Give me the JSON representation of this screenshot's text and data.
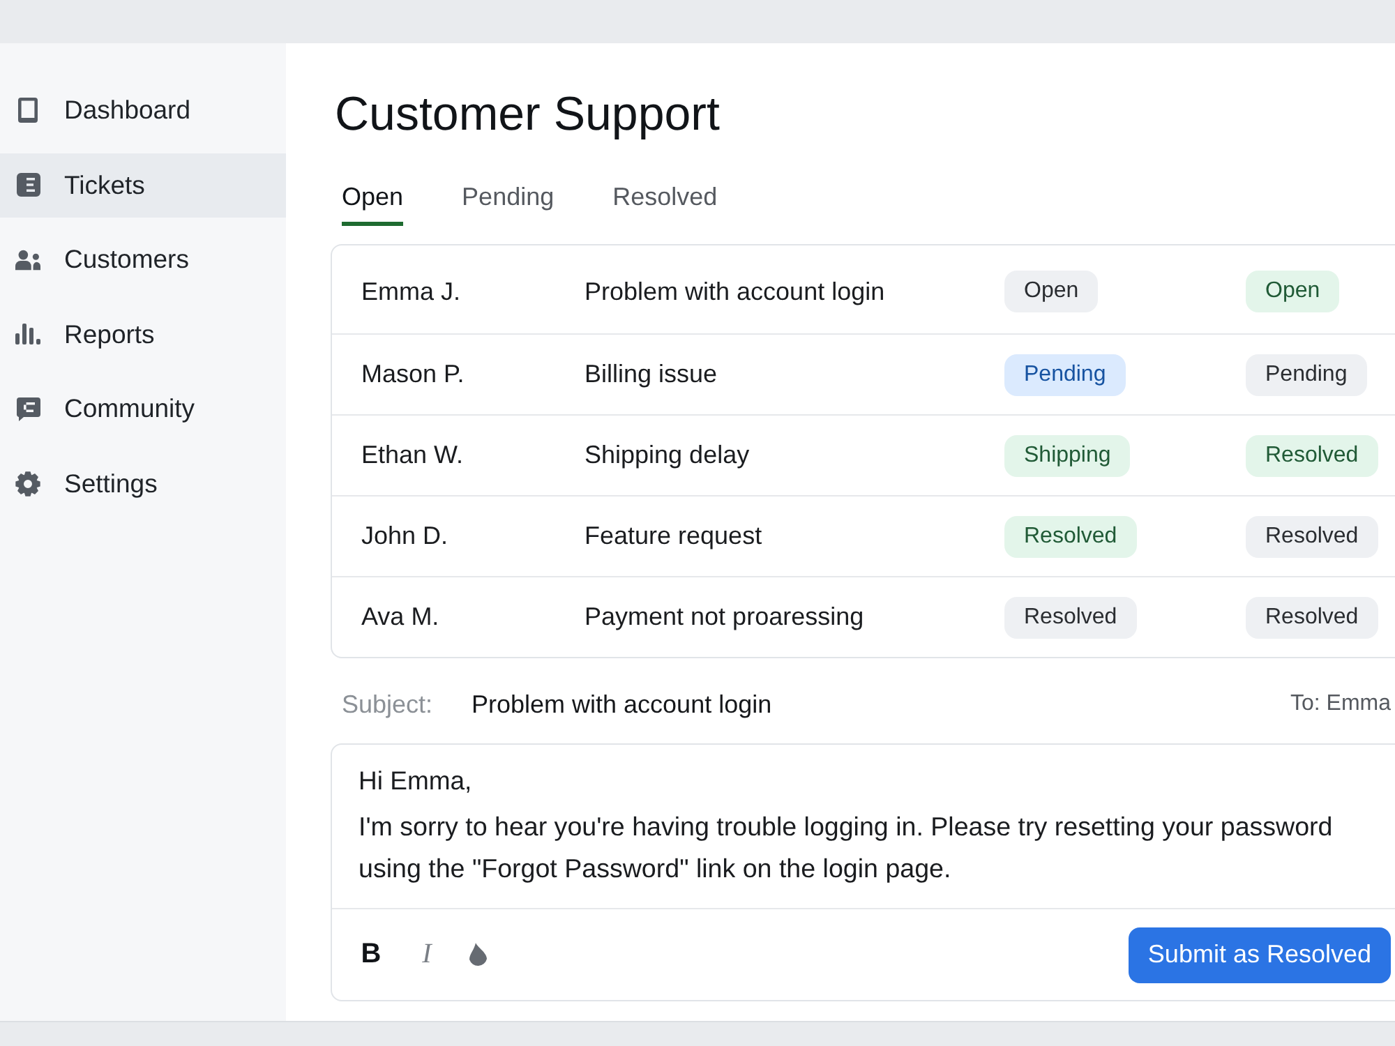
{
  "sidebar": {
    "items": [
      {
        "label": "Dashboard",
        "selected": false
      },
      {
        "label": "Tickets",
        "selected": true
      },
      {
        "label": "Customers",
        "selected": false
      },
      {
        "label": "Reports",
        "selected": false
      },
      {
        "label": "Community",
        "selected": false
      },
      {
        "label": "Settings",
        "selected": false
      }
    ]
  },
  "page": {
    "title": "Customer Support"
  },
  "tabs": [
    {
      "label": "Open",
      "selected": true
    },
    {
      "label": "Pending",
      "selected": false
    },
    {
      "label": "Resolved",
      "selected": false
    }
  ],
  "table": {
    "rows": [
      {
        "name": "Emma J.",
        "subject": "Problem with account login",
        "tags": [
          {
            "label": "Open",
            "color": "#eef0f3"
          },
          {
            "label": "Open",
            "color": "#e3f5ea"
          }
        ]
      },
      {
        "name": "Mason P.",
        "subject": "Billing issue",
        "tags": [
          {
            "label": "Pending",
            "color": "#dbeafe"
          },
          {
            "label": "Pending",
            "color": "#eef0f3"
          }
        ]
      },
      {
        "name": "Ethan W.",
        "subject": "Shipping delay",
        "tags": [
          {
            "label": "Shipping",
            "color": "#e3f5ea"
          },
          {
            "label": "Resolved",
            "color": "#e3f5ea"
          }
        ]
      },
      {
        "name": "John D.",
        "subject": "Feature request",
        "tags": [
          {
            "label": "Resolved",
            "color": "#e3f5ea"
          },
          {
            "label": "Resolved",
            "color": "#eef0f3"
          }
        ]
      },
      {
        "name": "Ava M.",
        "subject": "Payment not proaressing",
        "tags": [
          {
            "label": "Resolved",
            "color": "#eef0f3"
          },
          {
            "label": "Resolved",
            "color": "#eef0f3"
          }
        ]
      }
    ]
  },
  "composer": {
    "subject_label": "Subject:",
    "subject": "Problem with account login",
    "recipient": "To: Emma",
    "greeting": "Hi Emma,",
    "body": "I'm sorry to hear you're having trouble logging in. Please try resetting your password using the \"Forgot Password\" link on the login page.",
    "toolbar": [
      {
        "kind": "bold",
        "label": "B"
      },
      {
        "kind": "italic",
        "label": "I"
      },
      {
        "kind": "ink"
      }
    ],
    "submit": "Submit as Resolved"
  }
}
